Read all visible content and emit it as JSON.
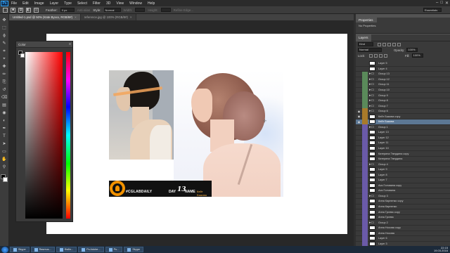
{
  "app": {
    "logo": "Ps",
    "menu": [
      "File",
      "Edit",
      "Image",
      "Layer",
      "Type",
      "Select",
      "Filter",
      "3D",
      "View",
      "Window",
      "Help"
    ],
    "window_controls": [
      "–",
      "□",
      "✕"
    ]
  },
  "options_bar": {
    "mode_label": "Feather:",
    "feather_value": "0 px",
    "antialias_label": "Anti-alias",
    "style_label": "Style:",
    "style_value": "Normal",
    "width_label": "Width:",
    "height_label": "Height:",
    "refine_label": "Refine Edge...",
    "workspace": "Essentials"
  },
  "tabs": [
    {
      "label": "Untitled-1.psd @ 50% (Kate Byxxx, RGB/8#)",
      "active": true
    },
    {
      "label": "reference.jpg @ 100% (RGB/8#)",
      "active": false
    }
  ],
  "toolbar": {
    "tools": [
      "move-tool",
      "marquee-tool",
      "lasso-tool",
      "quick-select-tool",
      "crop-tool",
      "eyedropper-tool",
      "healing-tool",
      "brush-tool",
      "clone-stamp-tool",
      "history-brush-tool",
      "eraser-tool",
      "gradient-tool",
      "blur-tool",
      "dodge-tool",
      "pen-tool",
      "type-tool",
      "path-select-tool",
      "shape-tool",
      "hand-tool",
      "zoom-tool"
    ],
    "glyphs": [
      "✥",
      "⬚",
      "ϕ",
      "✎",
      "⌗",
      "⌖",
      "✚",
      "✏",
      "⎘",
      "↺",
      "⌫",
      "▤",
      "◉",
      "◐",
      "✒",
      "T",
      "➤",
      "▭",
      "✋",
      "⚲"
    ]
  },
  "color_panel": {
    "title": "Color",
    "menu": "≡",
    "foreground": "#000000",
    "background": "#ffffff"
  },
  "canvas": {
    "banner_tag": "#CGLABDAILY",
    "banner_day_label": "DAY",
    "banner_day_number": "13",
    "banner_name_label": "NAME",
    "banner_author": "Кейт Быкова",
    "accent_color": "#f29200"
  },
  "properties_panel": {
    "title": "Properties",
    "value": "No Properties"
  },
  "layers_panel": {
    "tab": "Layers",
    "filter_label": "Kind",
    "blend_mode": "Normal",
    "opacity_label": "Opacity:",
    "opacity_value": "100%",
    "lock_label": "Lock:",
    "fill_label": "Fill:",
    "fill_value": "100%",
    "layers": [
      {
        "name": "Layer 5",
        "type": "layer",
        "visible": false,
        "color": ""
      },
      {
        "name": "Layer 4",
        "type": "layer",
        "visible": false,
        "color": ""
      },
      {
        "name": "Group 13",
        "type": "group",
        "visible": false,
        "color": "#5a8a5a"
      },
      {
        "name": "Group 12",
        "type": "group",
        "visible": false,
        "color": "#5a8a5a"
      },
      {
        "name": "Group 11",
        "type": "group",
        "visible": false,
        "color": "#5a8a5a"
      },
      {
        "name": "Group 10",
        "type": "group",
        "visible": false,
        "color": "#5a8a5a"
      },
      {
        "name": "Group 9",
        "type": "group",
        "visible": false,
        "color": "#5a8a5a"
      },
      {
        "name": "Group 8",
        "type": "group",
        "visible": false,
        "color": "#5a8a5a"
      },
      {
        "name": "Group 7",
        "type": "group",
        "visible": false,
        "color": "#5a8a5a"
      },
      {
        "name": "Group 6",
        "type": "group",
        "visible": true,
        "color": "#a87a2a"
      },
      {
        "name": "Кейт Быкова copy",
        "type": "layer",
        "visible": true,
        "color": "#a87a2a"
      },
      {
        "name": "Кейт Быкова",
        "type": "layer",
        "visible": true,
        "color": "#a87a2a",
        "selected": true
      },
      {
        "name": "Group 1",
        "type": "group",
        "visible": false,
        "color": "#6a5aa8"
      },
      {
        "name": "Layer 13",
        "type": "layer",
        "visible": false,
        "color": "#6a5aa8"
      },
      {
        "name": "Layer 12",
        "type": "layer",
        "visible": false,
        "color": "#6a5aa8"
      },
      {
        "name": "Layer 11",
        "type": "layer",
        "visible": false,
        "color": "#6a5aa8"
      },
      {
        "name": "Layer 10",
        "type": "layer",
        "visible": false,
        "color": "#6a5aa8"
      },
      {
        "name": "Катерина Твердина copy",
        "type": "layer",
        "visible": false,
        "color": "#6a5aa8"
      },
      {
        "name": "Катерина Твердина",
        "type": "layer",
        "visible": false,
        "color": "#6a5aa8"
      },
      {
        "name": "Group 4",
        "type": "group",
        "visible": false,
        "color": "#6a5aa8"
      },
      {
        "name": "Layer 9",
        "type": "layer",
        "visible": false,
        "color": "#6a5aa8"
      },
      {
        "name": "Layer 8",
        "type": "layer",
        "visible": false,
        "color": "#6a5aa8"
      },
      {
        "name": "Layer 7",
        "type": "layer",
        "visible": false,
        "color": "#6a5aa8"
      },
      {
        "name": "Ася Головина copy",
        "type": "layer",
        "visible": false,
        "color": "#6a5aa8"
      },
      {
        "name": "Ася Головина",
        "type": "layer",
        "visible": false,
        "color": "#6a5aa8"
      },
      {
        "name": "Group 3",
        "type": "group",
        "visible": false,
        "color": "#6a5aa8"
      },
      {
        "name": "Анна Карпенко copy",
        "type": "layer",
        "visible": false,
        "color": "#6a5aa8"
      },
      {
        "name": "Анна Карпенко",
        "type": "layer",
        "visible": false,
        "color": "#6a5aa8"
      },
      {
        "name": "Анна Гусева copy",
        "type": "layer",
        "visible": false,
        "color": "#6a5aa8"
      },
      {
        "name": "Анна Гусева",
        "type": "layer",
        "visible": false,
        "color": "#6a5aa8"
      },
      {
        "name": "Group 2",
        "type": "group",
        "visible": false,
        "color": "#6a5aa8"
      },
      {
        "name": "Анна Носова copy",
        "type": "layer",
        "visible": false,
        "color": "#6a5aa8"
      },
      {
        "name": "Анна Носова",
        "type": "layer",
        "visible": false,
        "color": "#6a5aa8"
      },
      {
        "name": "Layer 6",
        "type": "layer",
        "visible": false,
        "color": "#6a5aa8"
      },
      {
        "name": "Layer 3",
        "type": "layer",
        "visible": false,
        "color": "#6a5aa8"
      }
    ]
  },
  "taskbar": {
    "items": [
      "Skype",
      "Rasmus...",
      "Файл...",
      "Ps Adobe...",
      "Pu...",
      "Skype"
    ],
    "tray_time": "22:15",
    "tray_date": "19.03.2016"
  }
}
